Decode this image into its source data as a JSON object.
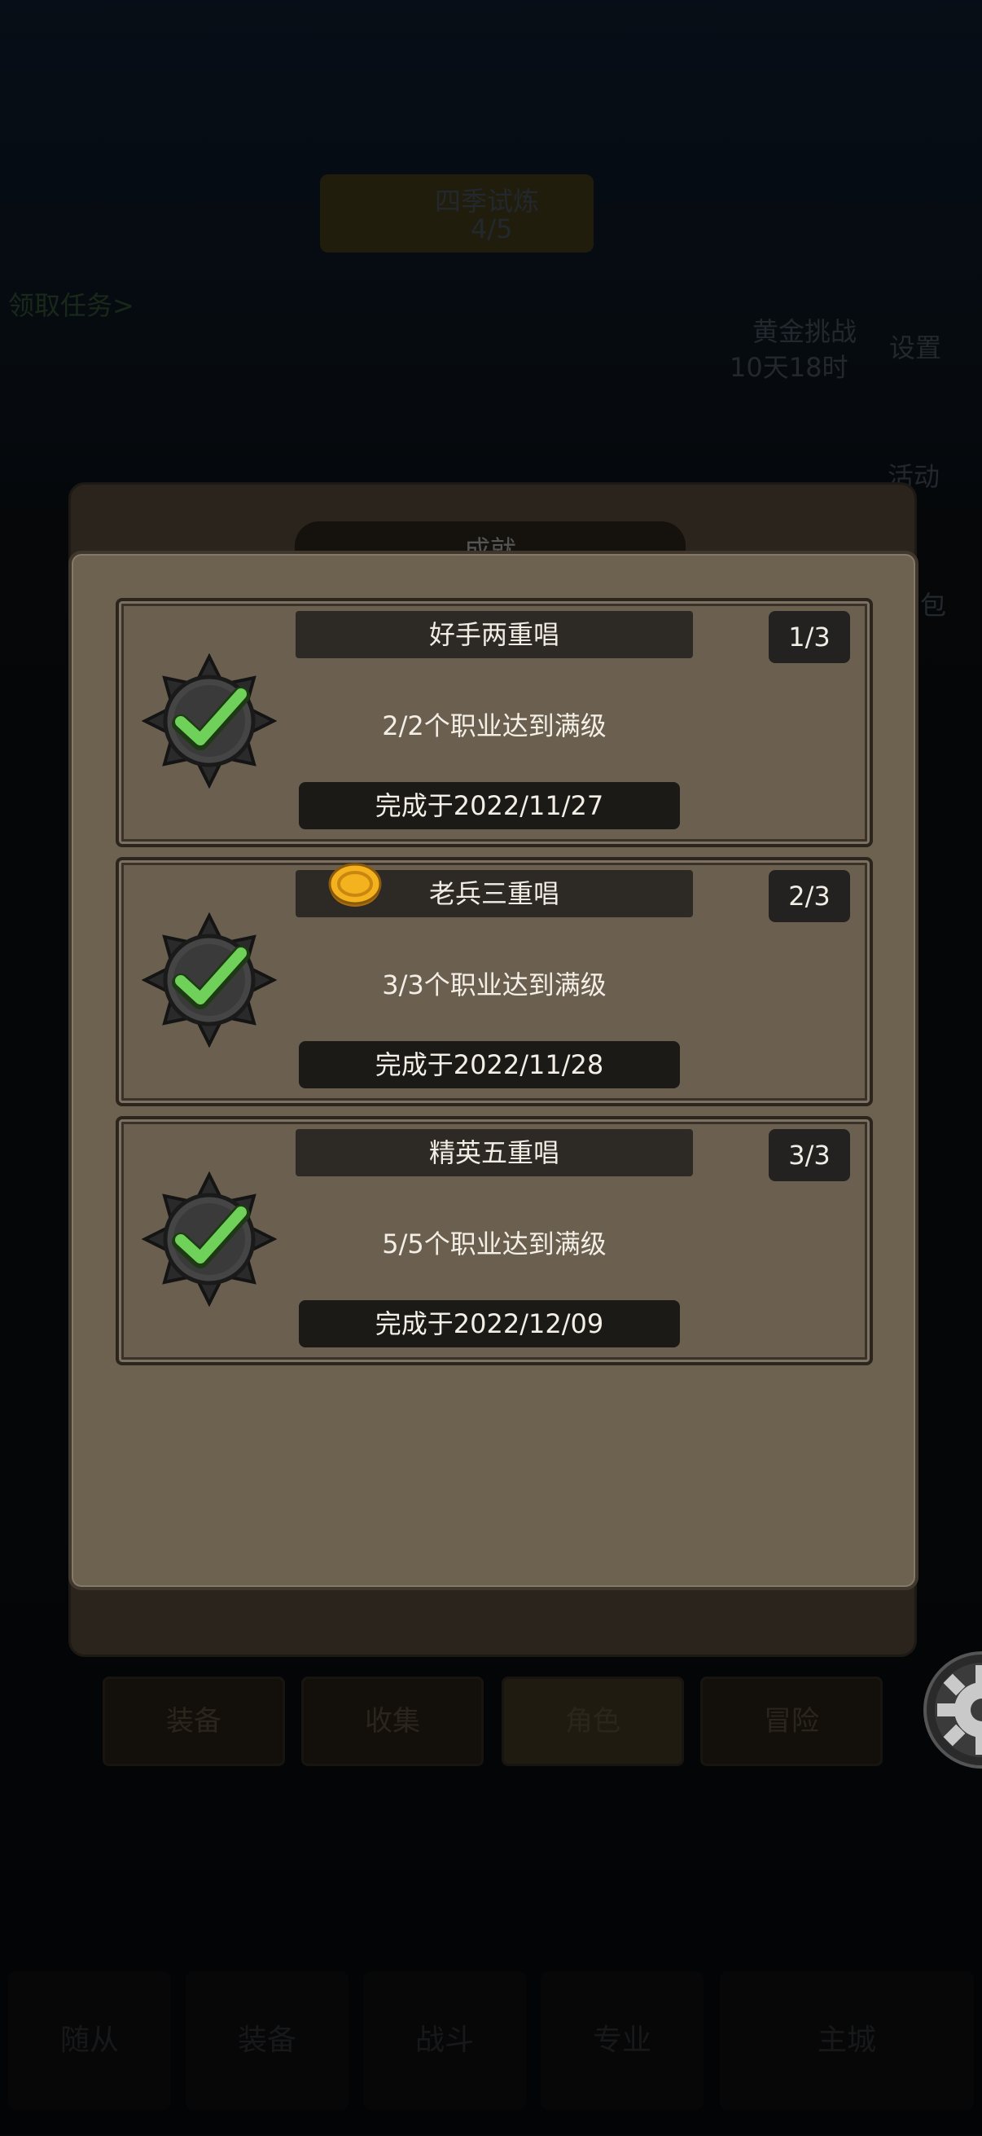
{
  "background": {
    "top_counter_title": "四季试炼",
    "top_counter_value": "4/5",
    "quest_hint": "领取任务>",
    "event_name": "黄金挑战",
    "event_time": "10天18时",
    "settings_label": "设置",
    "activity_label": "活动",
    "pack_label": "包",
    "achievements_title": "成就",
    "tabs": [
      "装备",
      "收集",
      "角色",
      "冒险"
    ],
    "bottom_nav": [
      "随从",
      "装备",
      "战斗",
      "专业",
      "主城"
    ]
  },
  "achievements": [
    {
      "title": "好手两重唱",
      "progress": "1/3",
      "description": "2/2个职业达到满级",
      "completed": "完成于2022/11/27",
      "has_coin": false
    },
    {
      "title": "老兵三重唱",
      "progress": "2/3",
      "description": "3/3个职业达到满级",
      "completed": "完成于2022/11/28",
      "has_coin": true
    },
    {
      "title": "精英五重唱",
      "progress": "3/3",
      "description": "5/5个职业达到满级",
      "completed": "完成于2022/12/09",
      "has_coin": false
    }
  ],
  "icons": {
    "medal": "check-medal-icon",
    "coin": "gold-coin-icon",
    "gear": "gear-icon"
  },
  "colors": {
    "panel": "#6d6250",
    "card_header": "#2d2924",
    "check_green": "#6fd15a"
  }
}
